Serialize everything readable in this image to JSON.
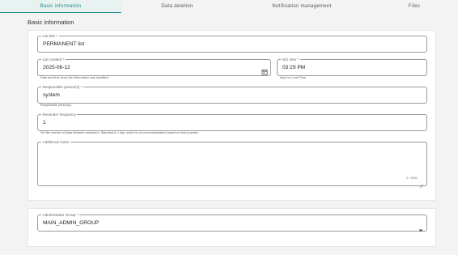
{
  "tabs": [
    {
      "label": "Basic information"
    },
    {
      "label": "Data deletion"
    },
    {
      "label": "Notification management"
    },
    {
      "label": "Files"
    }
  ],
  "section_title": "Basic information",
  "fields": {
    "list_title": {
      "label": "List title *",
      "value": "PERMANENT list"
    },
    "list_created": {
      "label": "List created *",
      "value": "2025-06-12",
      "helper": "Date and time when the information was identified"
    },
    "time": {
      "label": "Info time *",
      "value": "03:29 PM",
      "helper": "Input in Local Time"
    },
    "responsible": {
      "label": "Responsible person(s) *",
      "value": "system",
      "helper": "Responsible person(s)"
    },
    "reminder": {
      "label": "Reminder frequency",
      "value": "1",
      "helper": "Set the number of days between reminders. Standard is 1 day, which is our recommendation based on best practice."
    },
    "notes": {
      "label": "Additional notes",
      "value": "",
      "counter": "0 / 1500"
    },
    "admin_group": {
      "label": "Administrator Group *",
      "value": "MAIN_ADMIN_GROUP"
    }
  },
  "icons": {
    "calendar": "calendar-icon",
    "dropdown": "chevron-down-icon",
    "resize": "resize-handle-icon"
  },
  "colors": {
    "accent": "#1f8a8a",
    "tab_active_bg": "#e7f2f1",
    "page_bg": "#f3f3f3"
  }
}
